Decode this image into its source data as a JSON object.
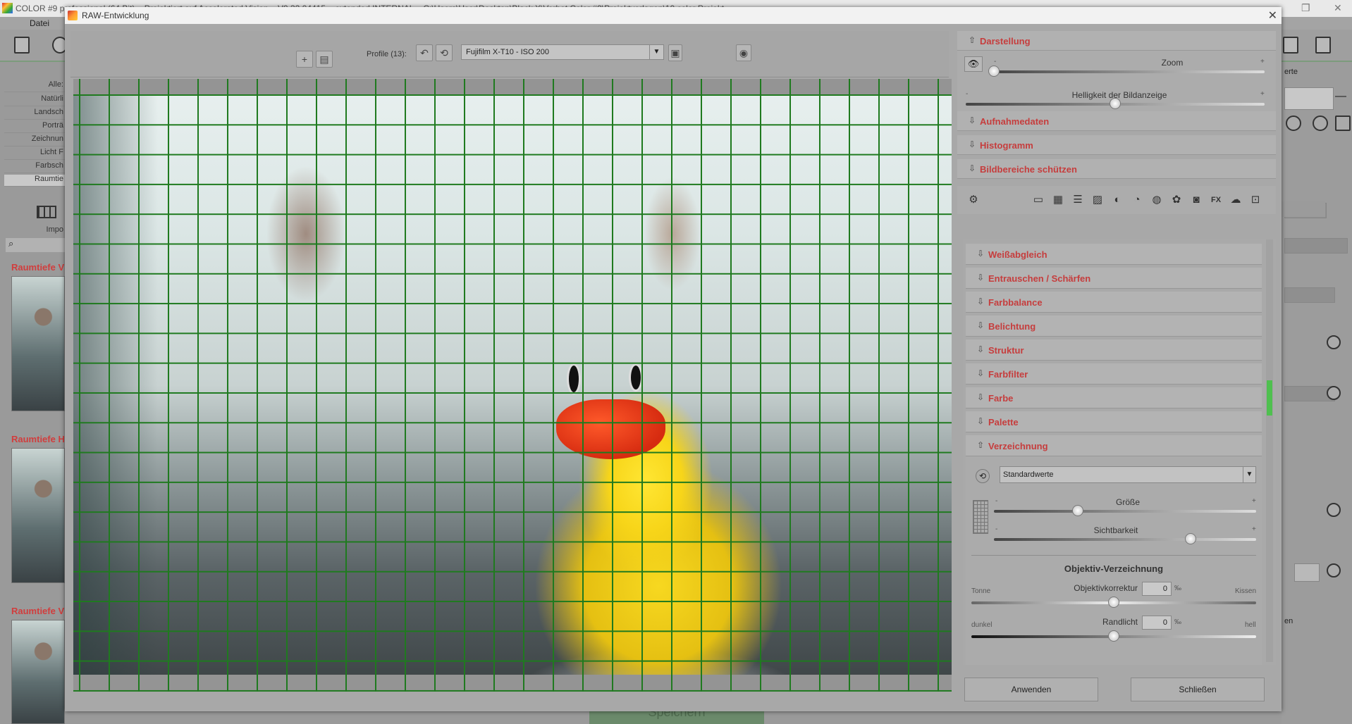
{
  "background_app": {
    "title": "COLOR #9 professional (64 Bit) – Projektiert auf Accelerated Vision – V9.32.04415 – extended INTERNAL – C:\\Users\\User\\Desktop\\Black X\\Verbot Color #9\\Projektvorlagen\\10 color Projekt",
    "menu_file": "Datei",
    "filters": {
      "all": "Alle:",
      "items": [
        "Natürli",
        "Landsch",
        "Porträ",
        "Zeichnun",
        "Licht F",
        "Farbsch",
        "Raumtie"
      ],
      "import": "Impo"
    },
    "thumb_titles": [
      "Raumtiefe V",
      "Raumtiefe H",
      "Raumtiefe V"
    ],
    "right_label": "erte",
    "right_label_2": "en",
    "save_button": "Speichern"
  },
  "dialog": {
    "title": "RAW-Entwicklung",
    "close": "✕",
    "toolbar": {
      "profiles_label": "Profile (13):",
      "profile_value": "Fujifilm X-T10 - ISO 200"
    },
    "panel": {
      "darstellung": "Darstellung",
      "zoom_label": "Zoom",
      "zoom_value": 0,
      "brightness_label": "Helligkeit der Bildanzeige",
      "brightness_value": 0.5,
      "aufnahmedaten": "Aufnahmedaten",
      "histogramm": "Histogramm",
      "bildbereiche": "Bildbereiche schützen",
      "sections": [
        "Weißabgleich",
        "Entrauschen / Schärfen",
        "Farbbalance",
        "Belichtung",
        "Struktur",
        "Farbfilter",
        "Farbe",
        "Palette"
      ],
      "verzeichnung": "Verzeichnung",
      "preset_value": "Standardwerte",
      "groesse_label": "Größe",
      "groesse_value": 0.32,
      "sichtbarkeit_label": "Sichtbarkeit",
      "sichtbarkeit_value": 0.75,
      "objektiv_title": "Objektiv-Verzeichnung",
      "objektivkorrektur_label": "Objektivkorrektur",
      "objektivkorrektur_value": "0",
      "unit": "‰",
      "tonne": "Tonne",
      "kissen": "Kissen",
      "randlicht_label": "Randlicht",
      "randlicht_value": "0",
      "dunkel": "dunkel",
      "hell": "hell",
      "minus": "-",
      "plus": "+"
    },
    "apply_button": "Anwenden",
    "close_button": "Schließen"
  }
}
